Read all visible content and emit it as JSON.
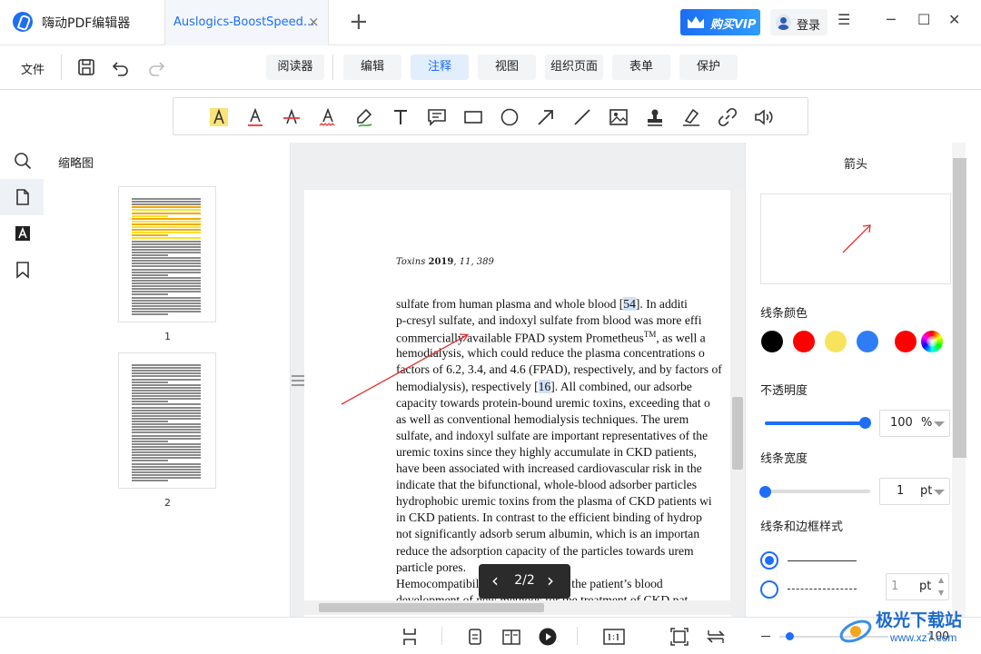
{
  "app": {
    "title": "嗨动PDF编辑器"
  },
  "tab": {
    "label": "Auslogics-BoostSpeed...",
    "close": "×",
    "new": "+"
  },
  "header": {
    "vip_label": "购买VIP",
    "login_label": "登录",
    "menu": "☰",
    "minimize": "─",
    "maximize": "☐",
    "close": "✕"
  },
  "menu": {
    "file": "文件",
    "tabs": [
      {
        "label": "阅读器",
        "active": false
      },
      {
        "label": "编辑",
        "active": false
      },
      {
        "label": "注释",
        "active": true
      },
      {
        "label": "视图",
        "active": false
      },
      {
        "label": "组织页面",
        "active": false
      },
      {
        "label": "表单",
        "active": false
      },
      {
        "label": "保护",
        "active": false
      }
    ]
  },
  "annotation_tools": [
    "highlight-icon",
    "underline-icon",
    "strikethrough-icon",
    "squiggly-icon",
    "freehand-icon",
    "text-icon",
    "comment-icon",
    "rectangle-icon",
    "ellipse-icon",
    "arrow-icon",
    "line-icon",
    "image-icon",
    "stamp-icon",
    "signature-icon",
    "link-icon",
    "audio-icon"
  ],
  "sidebar": {
    "title": "缩略图",
    "pages": [
      "1",
      "2"
    ]
  },
  "document": {
    "journal": {
      "name": "Toxins",
      "year": "2019",
      "rest": ", 11, 389"
    },
    "lines": [
      [
        "sulfate from human plasma and whole blood [",
        "54",
        "].  In additi"
      ],
      [
        "p-cresyl sulfate, and indoxyl sulfate from blood was more effi",
        "",
        ""
      ],
      [
        "commercially available FPAD system Prometheus",
        "TM",
        ", as well a"
      ],
      [
        "hemodialysis, which could reduce the plasma concentrations o",
        "",
        ""
      ],
      [
        "factors of 6.2, 3.4, and 4.6 (FPAD), respectively, and by factors of",
        "",
        ""
      ],
      [
        "hemodialysis), respectively [",
        "16",
        "].  All combined, our adsorbe"
      ],
      [
        "capacity towards protein-bound uremic toxins, exceeding that o",
        "",
        ""
      ],
      [
        "as well as conventional hemodialysis techniques.  The urem",
        "",
        ""
      ],
      [
        "sulfate, and indoxyl sulfate are important representatives of the",
        "",
        ""
      ],
      [
        "uremic toxins since they highly accumulate in CKD patients,",
        "",
        ""
      ],
      [
        "have been associated with increased cardiovascular risk in the",
        "",
        ""
      ],
      [
        "indicate that the bifunctional, whole-blood adsorber particles",
        "",
        ""
      ],
      [
        "hydrophobic uremic toxins from the plasma of CKD patients wi",
        "",
        ""
      ],
      [
        "in CKD patients.  In contrast to the efficient binding of hydrop",
        "",
        ""
      ],
      [
        "not significantly adsorb serum albumin, which is an importan",
        "",
        ""
      ],
      [
        "reduce the adsorption capacity of the particles towards urem",
        "",
        ""
      ],
      [
        "particle pores.",
        "",
        ""
      ],
      [
        "        Hemocompatibility in contact with the patient’s blood",
        "",
        ""
      ],
      [
        "development of new methods for the treatment of CKD pat",
        "",
        ""
      ]
    ],
    "page_indicator": "2/2",
    "prev": "‹",
    "next": "›"
  },
  "props": {
    "title": "箭头",
    "line_color_label": "线条颜色",
    "colors": [
      "#000000",
      "#ff0000",
      "#f7e35c",
      "#2f7df6",
      "#ff0000"
    ],
    "opacity_label": "不透明度",
    "opacity_value": "100",
    "opacity_unit": "%",
    "opacity_fraction": 1.0,
    "width_label": "线条宽度",
    "width_value": "1",
    "width_unit": "pt",
    "width_fraction": 0.0,
    "style_label": "线条和边框样式",
    "dash_value": "1",
    "dash_unit": "pt"
  },
  "status": {
    "zoom": "100"
  },
  "watermark": {
    "title": "极光下载站",
    "url": "www.xz7.com"
  }
}
